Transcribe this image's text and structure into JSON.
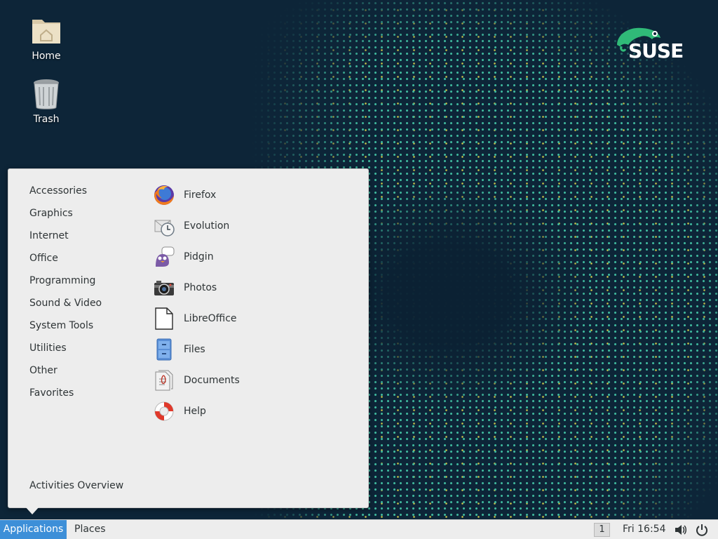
{
  "brand": {
    "name": "SUSE",
    "accent": "#3d8fd8",
    "logo_green": "#30ba78"
  },
  "desktop": {
    "icons": [
      {
        "label": "Home",
        "icon": "home-folder-icon"
      },
      {
        "label": "Trash",
        "icon": "trash-icon"
      }
    ]
  },
  "menu": {
    "categories": [
      "Accessories",
      "Graphics",
      "Internet",
      "Office",
      "Programming",
      "Sound & Video",
      "System Tools",
      "Utilities",
      "Other",
      "Favorites"
    ],
    "apps": [
      {
        "label": "Firefox",
        "icon": "firefox-icon"
      },
      {
        "label": "Evolution",
        "icon": "evolution-icon"
      },
      {
        "label": "Pidgin",
        "icon": "pidgin-icon"
      },
      {
        "label": "Photos",
        "icon": "photos-icon"
      },
      {
        "label": "LibreOffice",
        "icon": "libreoffice-icon"
      },
      {
        "label": "Files",
        "icon": "files-icon"
      },
      {
        "label": "Documents",
        "icon": "documents-icon"
      },
      {
        "label": "Help",
        "icon": "help-icon"
      }
    ],
    "activities": "Activities Overview"
  },
  "taskbar": {
    "applications": "Applications",
    "places": "Places",
    "workspace": "1",
    "clock": "Fri 16:54"
  }
}
